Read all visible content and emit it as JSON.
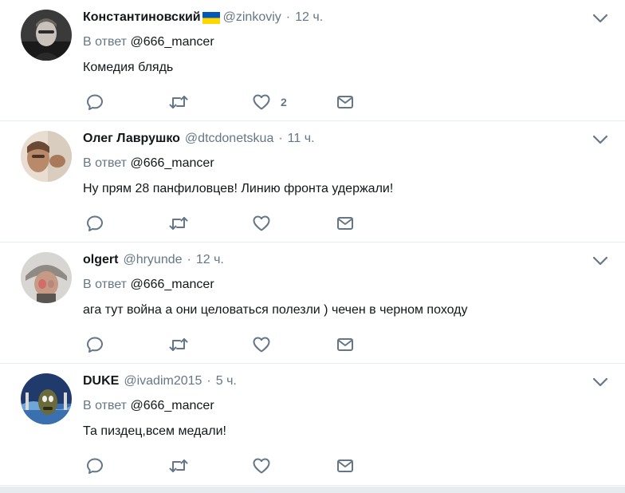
{
  "tweets": [
    {
      "fullname": "Константиновский",
      "has_flag": true,
      "screenname": "@zinkoviy",
      "dot": "·",
      "time": "12 ч.",
      "reply_prefix": "В ответ",
      "reply_handle": "@666_mancer",
      "text": "Комедия блядь",
      "like_count": "2"
    },
    {
      "fullname": "Олег Лаврушко",
      "has_flag": false,
      "screenname": "@dtcdonetskua",
      "dot": "·",
      "time": "11 ч.",
      "reply_prefix": "В ответ",
      "reply_handle": "@666_mancer",
      "text": "Ну прям 28 панфиловцев! Линию фронта удержали!",
      "like_count": ""
    },
    {
      "fullname": "olgert",
      "has_flag": false,
      "screenname": "@hryunde",
      "dot": "·",
      "time": "12 ч.",
      "reply_prefix": "В ответ",
      "reply_handle": "@666_mancer",
      "text": "ага тут война а они целоваться полезли  ) чечен в черном походу",
      "like_count": ""
    },
    {
      "fullname": "DUKE",
      "has_flag": false,
      "screenname": "@ivadim2015",
      "dot": "·",
      "time": "5 ч.",
      "reply_prefix": "В ответ",
      "reply_handle": "@666_mancer",
      "text": "Та пиздец,всем медали!",
      "like_count": ""
    }
  ],
  "icons": {
    "reply": "reply-icon",
    "retweet": "retweet-icon",
    "like": "heart-icon",
    "dm": "envelope-icon",
    "caret": "chevron-down-icon"
  },
  "colors": {
    "icon": "#657786",
    "text": "#14171a",
    "muted": "#657786",
    "divider": "#e6ecf0"
  }
}
